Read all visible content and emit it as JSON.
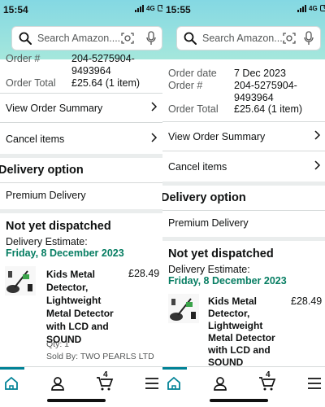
{
  "left": {
    "status": {
      "time": "15:54",
      "network": "4G",
      "battery": "6"
    },
    "search": {
      "placeholder": "Search Amazon...."
    },
    "order": {
      "order_number_label": "Order #",
      "order_number_value_line1": "204-5275904-",
      "order_number_value_line2": "9493964",
      "order_total_label": "Order Total",
      "order_total_value": "£25.64 (1 item)"
    },
    "view_summary": "View Order Summary",
    "cancel_items": "Cancel items",
    "delivery_option_heading": "Delivery option",
    "delivery_option_value": "Premium Delivery",
    "dispatch_heading": "Not yet dispatched",
    "delivery_estimate_label": "Delivery Estimate:",
    "delivery_estimate_date": "Friday, 8 December 2023",
    "product": {
      "title_lines": [
        "Kids Metal",
        "Detector,",
        "Lightweight",
        "Metal Detector",
        "with LCD and",
        "SOUND"
      ],
      "price": "£28.49",
      "qty": "Qty: 1",
      "sold_by": "Sold By: TWO PEARLS LTD"
    },
    "nav": {
      "cart_count": "4"
    }
  },
  "right": {
    "status": {
      "time": "15:55",
      "network": "4G",
      "battery": "6"
    },
    "search": {
      "placeholder": "Search Amazon...."
    },
    "order": {
      "order_date_label": "Order date",
      "order_date_value": "7 Dec 2023",
      "order_number_label": "Order #",
      "order_number_value_line1": "204-5275904-",
      "order_number_value_line2": "9493964",
      "order_total_label": "Order Total",
      "order_total_value": "£25.64 (1 item)"
    },
    "view_summary": "View Order Summary",
    "cancel_items": "Cancel items",
    "delivery_option_heading": "Delivery option",
    "delivery_option_value": "Premium Delivery",
    "dispatch_heading": "Not yet dispatched",
    "delivery_estimate_label": "Delivery Estimate:",
    "delivery_estimate_date": "Friday, 8 December 2023",
    "product": {
      "title_lines": [
        "Kids Metal",
        "Detector,",
        "Lightweight",
        "Metal Detector",
        "with LCD and",
        "SOUND"
      ],
      "price": "£28.49"
    },
    "nav": {
      "cart_count": "4"
    }
  },
  "icons": {
    "search": "search-icon",
    "camera": "camera-icon",
    "mic": "mic-icon",
    "chevron": "chevron-right-icon",
    "home": "home-icon",
    "account": "account-icon",
    "cart": "cart-icon",
    "menu": "menu-icon"
  },
  "colors": {
    "header_gradient_top": "#84d8e3",
    "header_gradient_bottom": "#a5e7dc",
    "delivery_date_green": "#067d62",
    "nav_active": "#008296"
  }
}
